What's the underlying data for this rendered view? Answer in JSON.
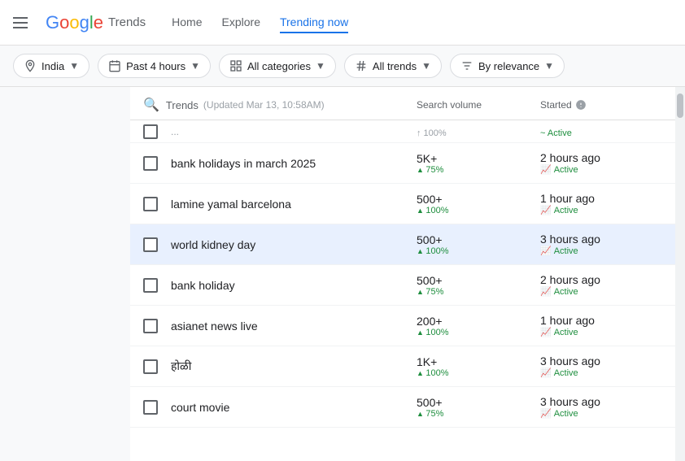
{
  "nav": {
    "hamburger_label": "Menu",
    "logo_text": "Google",
    "logo_trends": "Trends",
    "links": [
      {
        "label": "Home",
        "active": false
      },
      {
        "label": "Explore",
        "active": false
      },
      {
        "label": "Trending now",
        "active": true
      }
    ]
  },
  "filters": [
    {
      "id": "country",
      "icon": "location",
      "label": "India",
      "has_chevron": true
    },
    {
      "id": "time",
      "icon": "calendar",
      "label": "Past 4 hours",
      "has_chevron": true
    },
    {
      "id": "categories",
      "icon": "grid",
      "label": "All categories",
      "has_chevron": true
    },
    {
      "id": "trends",
      "icon": "hash",
      "label": "All trends",
      "has_chevron": true
    },
    {
      "id": "sort",
      "icon": "filter",
      "label": "By relevance",
      "has_chevron": true
    }
  ],
  "table": {
    "header": {
      "trends_label": "Trends",
      "updated_text": "(Updated Mar 13, 10:58AM)",
      "volume_label": "Search volume",
      "started_label": "Started"
    },
    "partial_row": {
      "volume": "1-100%",
      "started": "Active"
    },
    "rows": [
      {
        "id": 1,
        "title": "bank holidays in march 2025",
        "volume": "5K+",
        "volume_change": "75%",
        "started": "2 hours ago",
        "status": "Active",
        "highlighted": false
      },
      {
        "id": 2,
        "title": "lamine yamal barcelona",
        "volume": "500+",
        "volume_change": "100%",
        "started": "1 hour ago",
        "status": "Active",
        "highlighted": false
      },
      {
        "id": 3,
        "title": "world kidney day",
        "volume": "500+",
        "volume_change": "100%",
        "started": "3 hours ago",
        "status": "Active",
        "highlighted": true
      },
      {
        "id": 4,
        "title": "bank holiday",
        "volume": "500+",
        "volume_change": "75%",
        "started": "2 hours ago",
        "status": "Active",
        "highlighted": false
      },
      {
        "id": 5,
        "title": "asianet news live",
        "volume": "200+",
        "volume_change": "100%",
        "started": "1 hour ago",
        "status": "Active",
        "highlighted": false
      },
      {
        "id": 6,
        "title": "होळी",
        "volume": "1K+",
        "volume_change": "100%",
        "started": "3 hours ago",
        "status": "Active",
        "highlighted": false
      },
      {
        "id": 7,
        "title": "court movie",
        "volume": "500+",
        "volume_change": "75%",
        "started": "3 hours ago",
        "status": "Active",
        "highlighted": false
      }
    ]
  },
  "colors": {
    "active_green": "#1e8e3e",
    "link_blue": "#1a73e8",
    "highlight_bg": "#e8f0fe"
  }
}
